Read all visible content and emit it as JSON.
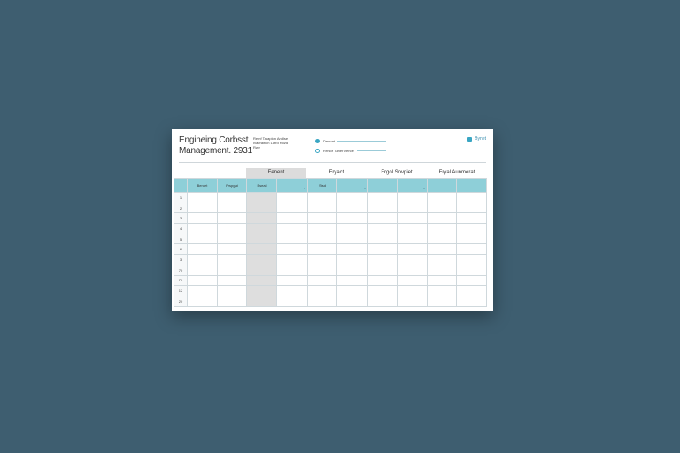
{
  "title": "Engineing Corbsst Management. 2931",
  "notes": [
    "Remf Taraplon Andlse",
    "Ivaeraltion Lutrd Rozd",
    "Rwe"
  ],
  "legend": [
    {
      "label": "Deonat",
      "style": "filled"
    },
    {
      "label": "Rrmor Tuner Vende",
      "style": "open"
    }
  ],
  "topright": {
    "label": "Bynet"
  },
  "group_headers": [
    "Fenent",
    "Fryact",
    "Frgol Sovpiet",
    "Fryal Aunmerat"
  ],
  "columns": [
    {
      "label": "",
      "sort": false
    },
    {
      "label": "Beroet",
      "sort": false
    },
    {
      "label": "Frspgat",
      "sort": false
    },
    {
      "label": "Bseal",
      "sort": false
    },
    {
      "label": "",
      "sort": true
    },
    {
      "label": "Stsd",
      "sort": false
    },
    {
      "label": "",
      "sort": true
    },
    {
      "label": "",
      "sort": false
    },
    {
      "label": "",
      "sort": true
    },
    {
      "label": "",
      "sort": false
    },
    {
      "label": "",
      "sort": false
    }
  ],
  "row_numbers": [
    "1",
    "2",
    "3",
    "4",
    "5",
    "6",
    "3",
    "70",
    "70",
    "12",
    "20"
  ],
  "colors": {
    "background": "#3e5e70",
    "header": "#8ecfd8",
    "shade": "#dedede"
  }
}
